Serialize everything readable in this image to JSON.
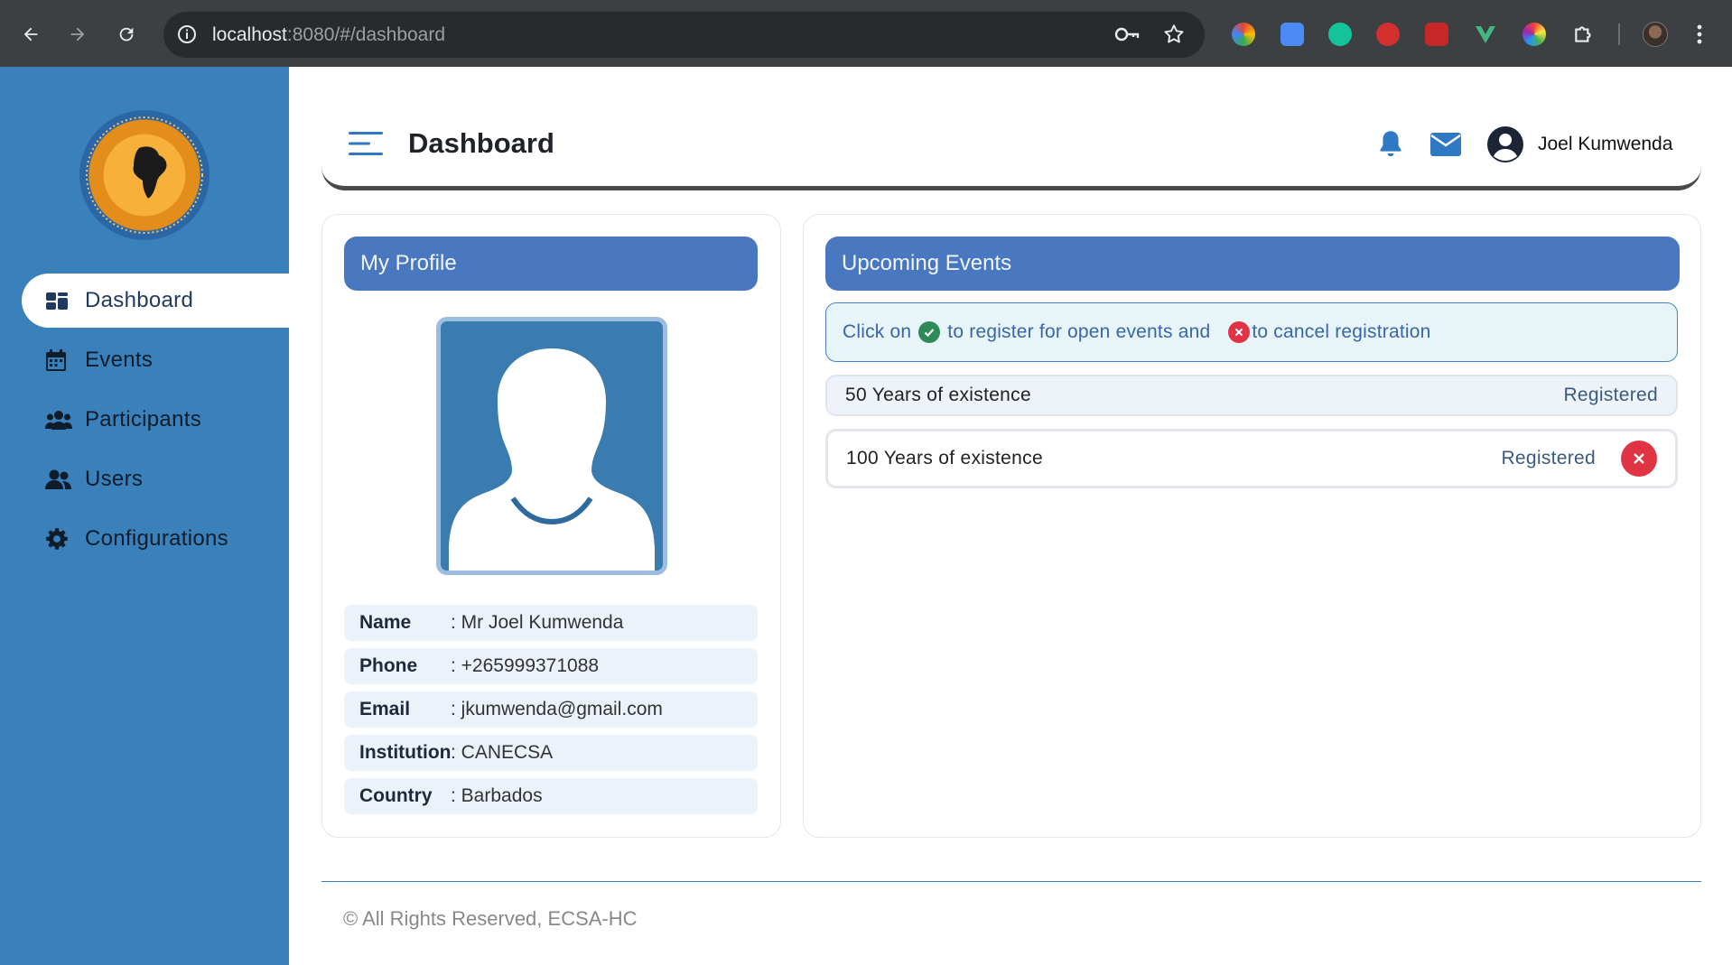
{
  "browser": {
    "url_host": "localhost",
    "url_rest": ":8080/#/dashboard"
  },
  "sidebar": {
    "items": [
      {
        "label": "Dashboard",
        "icon": "dashboard-icon",
        "active": true
      },
      {
        "label": "Events",
        "icon": "calendar-icon",
        "active": false
      },
      {
        "label": "Participants",
        "icon": "people-group-icon",
        "active": false
      },
      {
        "label": "Users",
        "icon": "users-icon",
        "active": false
      },
      {
        "label": "Configurations",
        "icon": "gear-icon",
        "active": false
      }
    ]
  },
  "header": {
    "title": "Dashboard",
    "user_name": "Joel Kumwenda"
  },
  "profile": {
    "title": "My Profile",
    "fields": [
      {
        "label": "Name",
        "value": ": Mr Joel Kumwenda"
      },
      {
        "label": "Phone",
        "value": ": +265999371088"
      },
      {
        "label": "Email",
        "value": ": jkumwenda@gmail.com"
      },
      {
        "label": "Institution",
        "value": ": CANECSA"
      },
      {
        "label": "Country",
        "value": ": Barbados"
      }
    ]
  },
  "events": {
    "title": "Upcoming Events",
    "notice_part1": "Click on",
    "notice_part2": "to register for open events and",
    "notice_part3": "to cancel registration",
    "items": [
      {
        "name": "50 Years of existence",
        "status": "Registered",
        "cancellable": false
      },
      {
        "name": "100 Years of existence",
        "status": "Registered",
        "cancellable": true
      }
    ]
  },
  "footer": {
    "text": "© All Rights Reserved, ECSA-HC"
  },
  "colors": {
    "sidebar": "#3a81bc",
    "card_title": "#4978c1",
    "accent": "#2f78c4",
    "danger": "#e03444",
    "success": "#2e8b57"
  }
}
